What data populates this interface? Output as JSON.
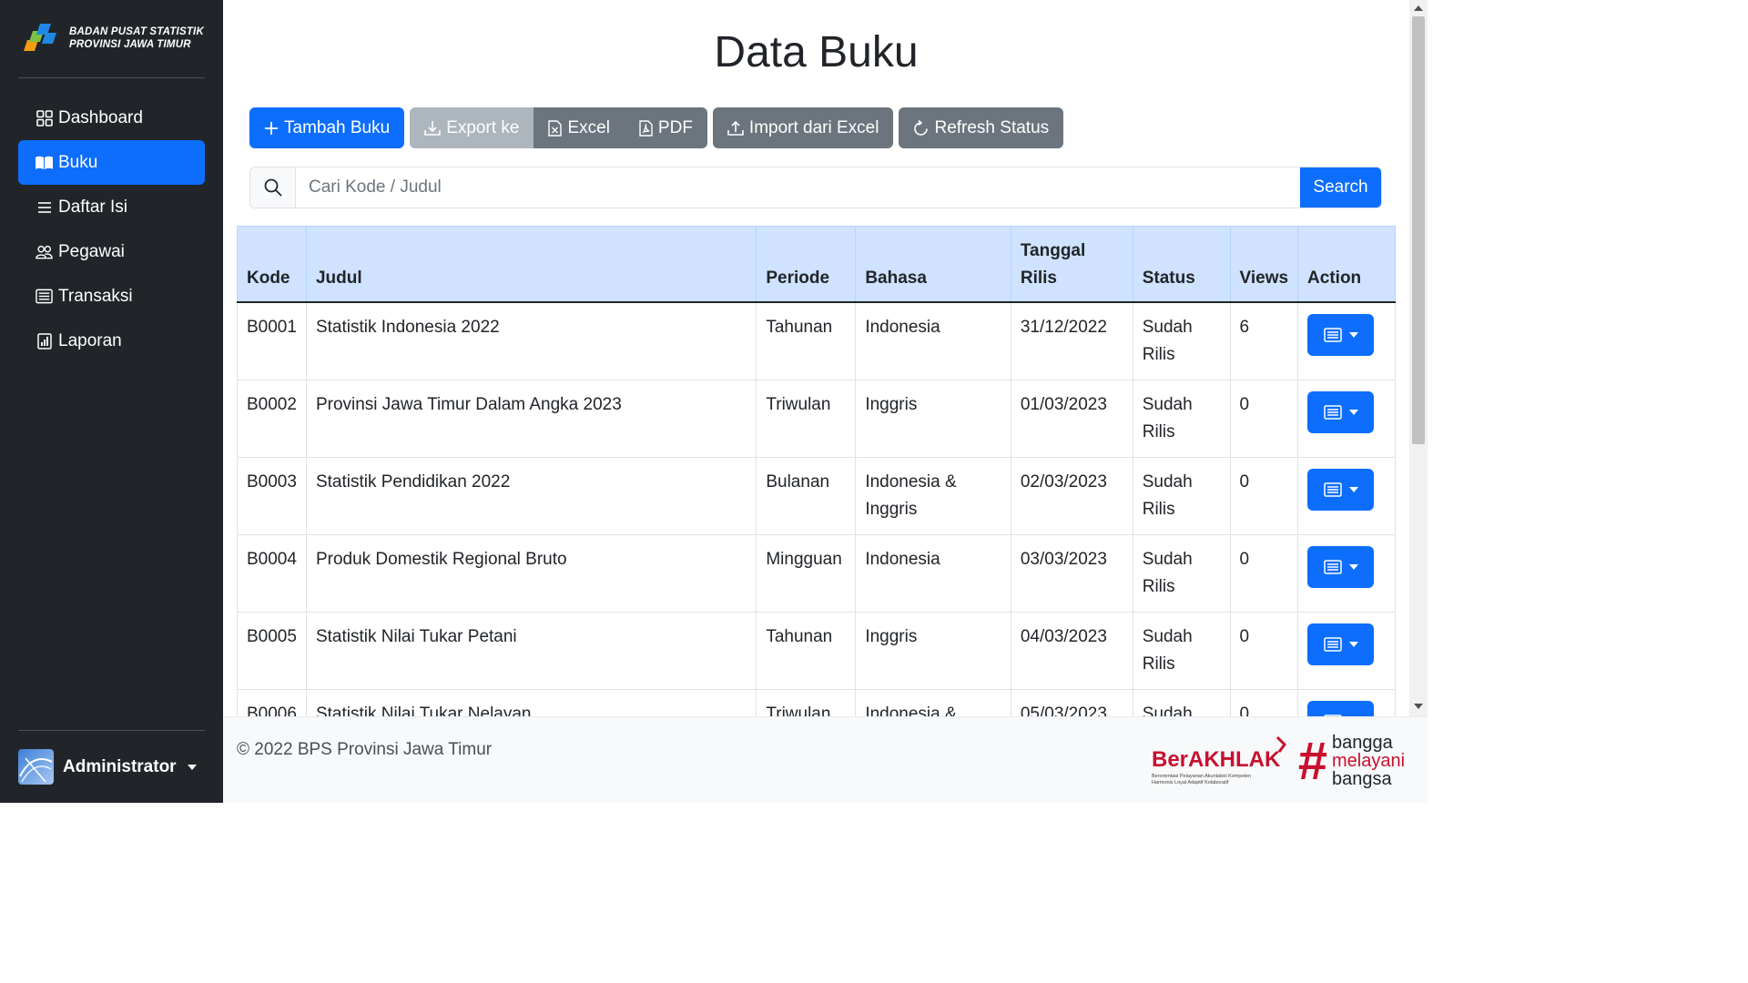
{
  "sidebar": {
    "brand_line1": "BADAN PUSAT STATISTIK",
    "brand_line2": "PROVINSI JAWA TIMUR",
    "items": [
      {
        "label": "Dashboard",
        "icon": "grid-icon",
        "active": false
      },
      {
        "label": "Buku",
        "icon": "book-icon",
        "active": true
      },
      {
        "label": "Daftar Isi",
        "icon": "list-icon",
        "active": false
      },
      {
        "label": "Pegawai",
        "icon": "people-icon",
        "active": false
      },
      {
        "label": "Transaksi",
        "icon": "card-list-icon",
        "active": false
      },
      {
        "label": "Laporan",
        "icon": "bar-chart-icon",
        "active": false
      }
    ],
    "user_name": "Administrator"
  },
  "page": {
    "title": "Data Buku"
  },
  "toolbar": {
    "add_label": "Tambah Buku",
    "export_label": "Export ke",
    "excel_label": "Excel",
    "pdf_label": "PDF",
    "import_label": "Import dari Excel",
    "refresh_label": "Refresh Status"
  },
  "search": {
    "placeholder": "Cari Kode / Judul",
    "button_label": "Search"
  },
  "table": {
    "headers": [
      "Kode",
      "Judul",
      "Periode",
      "Bahasa",
      "Tanggal Rilis",
      "Status",
      "Views",
      "Action"
    ],
    "rows": [
      {
        "kode": "B0001",
        "judul": "Statistik Indonesia 2022",
        "periode": "Tahunan",
        "bahasa": "Indonesia",
        "tanggal": "31/12/2022",
        "status": "Sudah Rilis",
        "views": "6"
      },
      {
        "kode": "B0002",
        "judul": "Provinsi Jawa Timur Dalam Angka 2023",
        "periode": "Triwulan",
        "bahasa": "Inggris",
        "tanggal": "01/03/2023",
        "status": "Sudah Rilis",
        "views": "0"
      },
      {
        "kode": "B0003",
        "judul": "Statistik Pendidikan 2022",
        "periode": "Bulanan",
        "bahasa": "Indonesia & Inggris",
        "tanggal": "02/03/2023",
        "status": "Sudah Rilis",
        "views": "0"
      },
      {
        "kode": "B0004",
        "judul": "Produk Domestik Regional Bruto",
        "periode": "Mingguan",
        "bahasa": "Indonesia",
        "tanggal": "03/03/2023",
        "status": "Sudah Rilis",
        "views": "0"
      },
      {
        "kode": "B0005",
        "judul": "Statistik Nilai Tukar Petani",
        "periode": "Tahunan",
        "bahasa": "Inggris",
        "tanggal": "04/03/2023",
        "status": "Sudah Rilis",
        "views": "0"
      },
      {
        "kode": "B0006",
        "judul": "Statistik Nilai Tukar Nelayan",
        "periode": "Triwulan",
        "bahasa": "Indonesia & Inggris",
        "tanggal": "05/03/2023",
        "status": "Sudah Rilis",
        "views": "0"
      }
    ]
  },
  "footer": {
    "copyright": "© 2022 BPS Provinsi Jawa Timur",
    "berakhlak_logo": "BerAKHLAK",
    "berakhlak_tagline": "Berorientasi Pelayanan Akuntabel Kompeten Harmonis Loyal Adaptif Kolaboratif",
    "bangga_logo": "#bangga melayani bangsa"
  },
  "colors": {
    "sidebar_bg": "#212529",
    "primary": "#0d6efd",
    "table_header_bg": "#cfe2ff"
  }
}
